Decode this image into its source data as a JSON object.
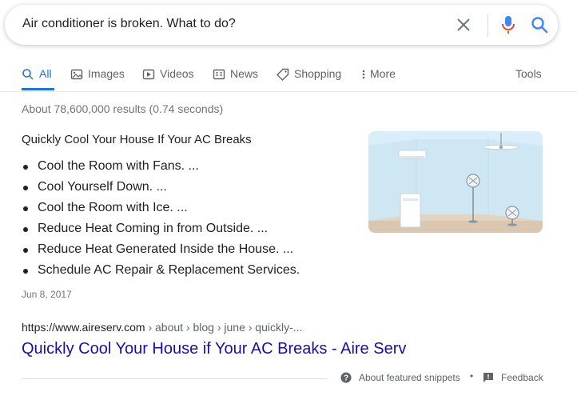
{
  "search": {
    "query": "Air conditioner is broken. What to do?",
    "icons": [
      "close-icon",
      "microphone-icon",
      "search-icon"
    ]
  },
  "tabs": [
    {
      "label": "All",
      "icon": "search-icon",
      "active": true
    },
    {
      "label": "Images",
      "icon": "image-icon"
    },
    {
      "label": "Videos",
      "icon": "play-icon"
    },
    {
      "label": "News",
      "icon": "news-icon"
    },
    {
      "label": "Shopping",
      "icon": "tag-icon"
    },
    {
      "label": "More",
      "icon": "more-vert-icon"
    }
  ],
  "tools_label": "Tools",
  "stats": "About 78,600,000 results (0.74 seconds)",
  "snippet": {
    "title": "Quickly Cool Your House If Your AC Breaks",
    "items": [
      "Cool the Room with Fans. ...",
      "Cool Yourself Down. ...",
      "Cool the Room with Ice. ...",
      "Reduce Heat Coming in from Outside. ...",
      "Reduce Heat Generated Inside the House. ...",
      "Schedule AC Repair & Replacement Services."
    ],
    "date": "Jun 8, 2017",
    "image": "room-with-air-conditioner-and-fans"
  },
  "result": {
    "url_domain": "https://www.aireserv.com",
    "url_path": " › about › blog › june › quickly-...",
    "title": "Quickly Cool Your House if Your AC Breaks - Aire Serv"
  },
  "footer": {
    "about_label": "About featured snippets",
    "separator": "•",
    "feedback_label": "Feedback"
  },
  "colors": {
    "link": "#1a0dab",
    "accent": "#1a73e8",
    "secondary_text": "#70757a"
  }
}
